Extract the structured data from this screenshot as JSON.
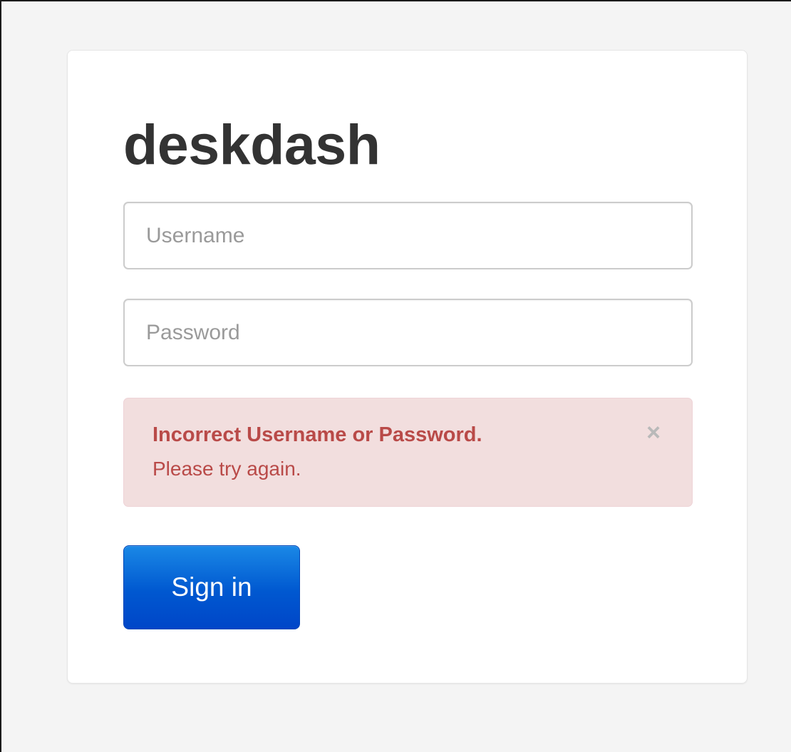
{
  "app": {
    "brand": "deskdash"
  },
  "login": {
    "username_placeholder": "Username",
    "username_value": "",
    "password_placeholder": "Password",
    "password_value": "",
    "signin_label": "Sign in"
  },
  "alert": {
    "title": "Incorrect Username or Password.",
    "text": "Please try again.",
    "close_icon": "close-icon",
    "close_glyph": "×"
  },
  "colors": {
    "page_background": "#f4f4f4",
    "card_background": "#ffffff",
    "alert_background": "#f2dede",
    "alert_text": "#b94a48",
    "primary_button": "#0058d0"
  }
}
